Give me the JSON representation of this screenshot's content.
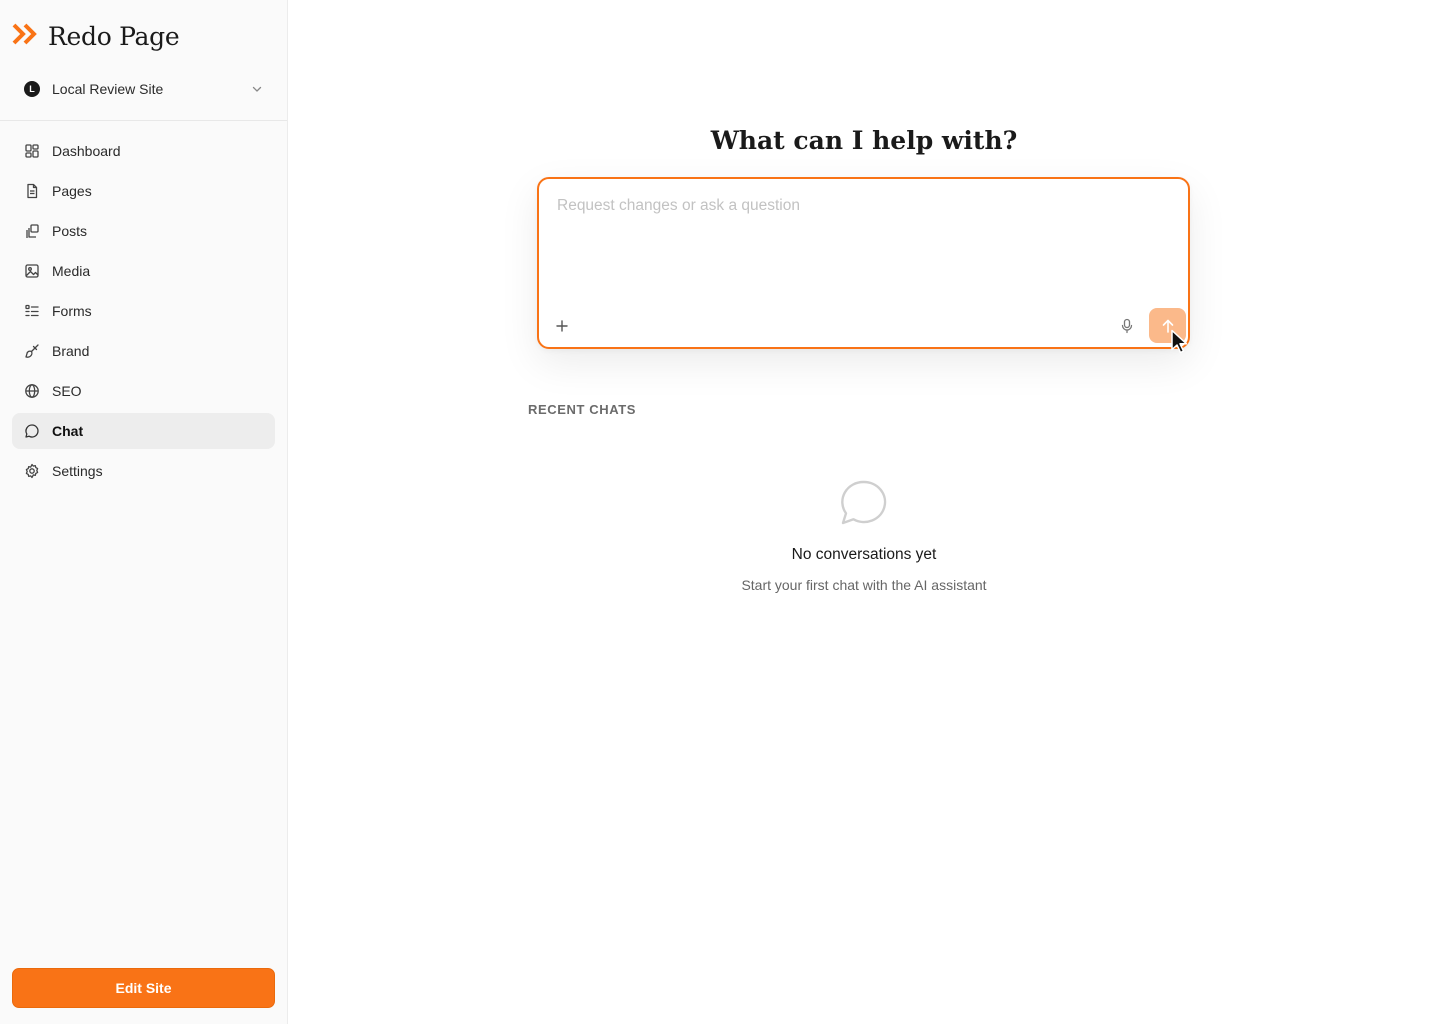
{
  "app": {
    "name": "Redo Page",
    "accent": "#f97316"
  },
  "site_switcher": {
    "initial": "L",
    "name": "Local Review Site",
    "icon": "chevron-down-icon"
  },
  "nav": {
    "items": [
      {
        "label": "Dashboard",
        "icon": "dashboard-icon",
        "active": false
      },
      {
        "label": "Pages",
        "icon": "page-icon",
        "active": false
      },
      {
        "label": "Posts",
        "icon": "posts-icon",
        "active": false
      },
      {
        "label": "Media",
        "icon": "image-icon",
        "active": false
      },
      {
        "label": "Forms",
        "icon": "list-icon",
        "active": false
      },
      {
        "label": "Brand",
        "icon": "brush-icon",
        "active": false
      },
      {
        "label": "SEO",
        "icon": "globe-icon",
        "active": false
      },
      {
        "label": "Chat",
        "icon": "chat-icon",
        "active": true
      },
      {
        "label": "Settings",
        "icon": "gear-icon",
        "active": false
      }
    ]
  },
  "footer": {
    "edit_label": "Edit Site"
  },
  "main": {
    "title": "What can I help with?",
    "composer": {
      "value": "",
      "placeholder": "Request changes or ask a question"
    },
    "recent_label": "RECENT CHATS",
    "empty": {
      "title": "No conversations yet",
      "subtitle": "Start your first chat with the AI assistant"
    }
  }
}
